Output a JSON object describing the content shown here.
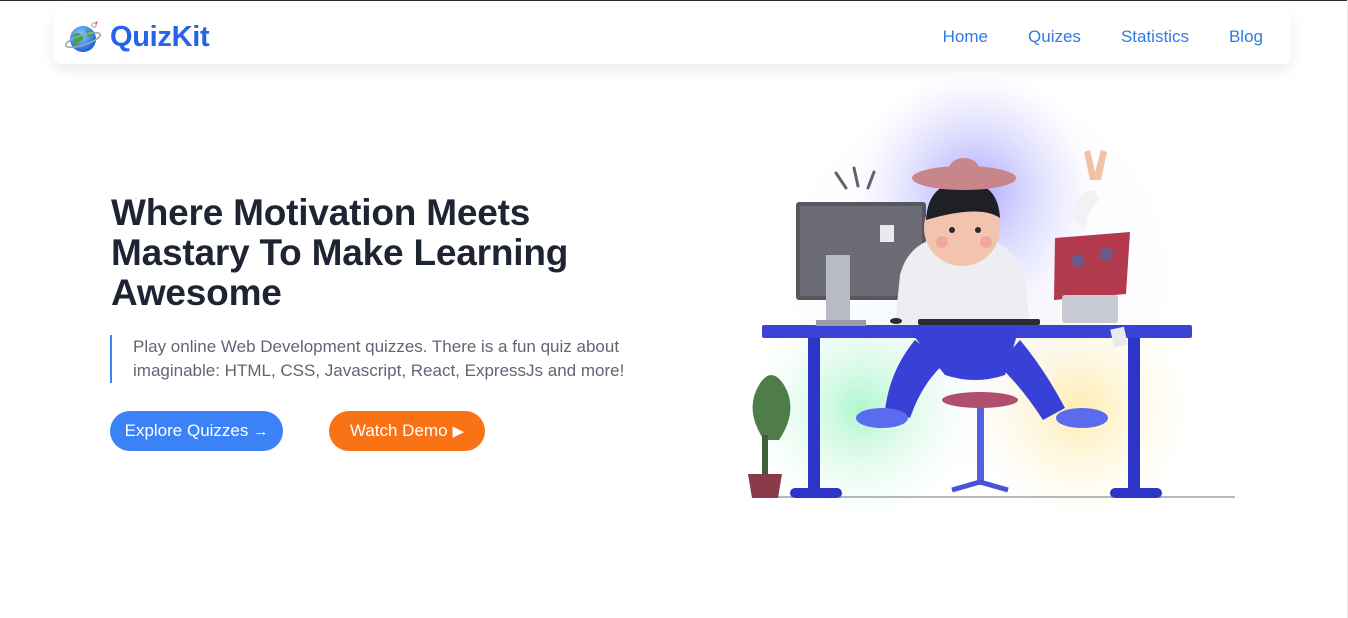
{
  "brand": {
    "name": "QuizKit",
    "logo_icon": "globe-rocket-icon",
    "color": "#2563eb"
  },
  "nav": {
    "items": [
      {
        "label": "Home"
      },
      {
        "label": "Quizes"
      },
      {
        "label": "Statistics"
      },
      {
        "label": "Blog"
      }
    ],
    "link_color": "#2f7ae5"
  },
  "hero": {
    "title": "Where Motivation Meets Mastary To Make Learning Awesome",
    "description": "Play online Web Development quizzes. There is a fun quiz about imaginable: HTML, CSS, Javascript, React, ExpressJs and more!",
    "explore_button": {
      "label": "Explore Quizzes",
      "icon": "arrow-right-icon",
      "glyph": "→",
      "color": "#3b82f6"
    },
    "demo_button": {
      "label": "Watch Demo",
      "icon": "play-icon",
      "glyph": "▶",
      "color": "#f97316"
    },
    "illustration": "person-at-desk-illustration"
  }
}
